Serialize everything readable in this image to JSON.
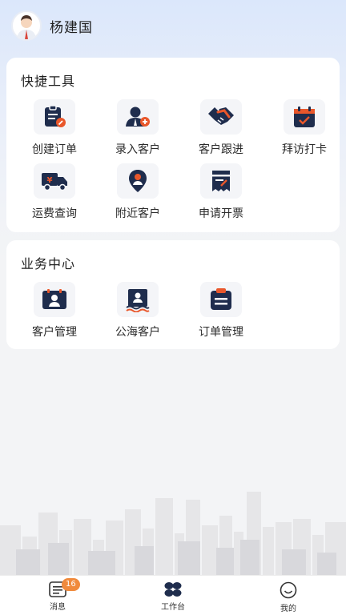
{
  "header": {
    "username": "杨建国"
  },
  "quick_tools": {
    "title": "快捷工具",
    "items": [
      {
        "label": "创建订单",
        "icon": "create-order-icon"
      },
      {
        "label": "录入客户",
        "icon": "add-customer-icon"
      },
      {
        "label": "客户跟进",
        "icon": "handshake-icon"
      },
      {
        "label": "拜访打卡",
        "icon": "calendar-check-icon"
      },
      {
        "label": "运费查询",
        "icon": "truck-icon"
      },
      {
        "label": "附近客户",
        "icon": "location-pin-icon"
      },
      {
        "label": "申请开票",
        "icon": "invoice-icon"
      }
    ]
  },
  "business_center": {
    "title": "业务中心",
    "items": [
      {
        "label": "客户管理",
        "icon": "customer-card-icon"
      },
      {
        "label": "公海客户",
        "icon": "sea-customer-icon"
      },
      {
        "label": "订单管理",
        "icon": "order-list-icon"
      }
    ]
  },
  "tabbar": {
    "items": [
      {
        "label": "消息",
        "icon": "message-icon",
        "badge": "16"
      },
      {
        "label": "工作台",
        "icon": "workbench-icon"
      },
      {
        "label": "我的",
        "icon": "profile-icon"
      }
    ]
  },
  "colors": {
    "icon_dark": "#1f2d4d",
    "icon_accent": "#e9572b",
    "badge": "#f08a3c"
  }
}
